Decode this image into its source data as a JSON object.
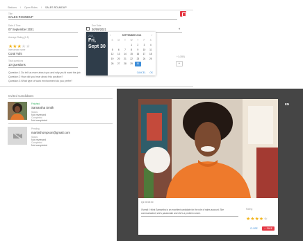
{
  "breadcrumb": [
    "Stations",
    "Open Roles",
    "SALES ROUNDUP"
  ],
  "form": {
    "title_label": "Title",
    "title_value": "SALES ROUNDUP",
    "date_label": "Date & Time",
    "date_value": "07 September 2021",
    "due_label": "Due Date",
    "due_value": "30/09/2021",
    "rating_label": "Average Rating (1-5)",
    "rating_value": 3,
    "rating_max": 5,
    "interviewer_label": "Interviewer name",
    "interviewer_value": "Coral Vuht",
    "questions_label": "Total questions",
    "questions_value": "10 Questions",
    "questions": [
      "Question 1 Do tell us more about you and why you'd want the job",
      "Question 2 How did you hear about this position?",
      "Question 3 What type of work environment do you prefer?"
    ],
    "side_note": "+1 (555)"
  },
  "datepicker": {
    "year": "2021",
    "weekday": "Fri,",
    "day_label": "Sept 30",
    "month_title": "SEPTEMBER 2021",
    "weekdays": [
      "S",
      "M",
      "T",
      "W",
      "T",
      "F",
      "S"
    ],
    "weeks": [
      [
        "",
        "",
        "",
        "1",
        "2",
        "3",
        "4"
      ],
      [
        "5",
        "6",
        "7",
        "8",
        "9",
        "10",
        "11"
      ],
      [
        "12",
        "13",
        "14",
        "15",
        "16",
        "17",
        "18"
      ],
      [
        "19",
        "20",
        "21",
        "22",
        "23",
        "24",
        "25"
      ],
      [
        "26",
        "27",
        "28",
        "29",
        "30",
        "",
        ""
      ]
    ],
    "selected": "30",
    "cancel": "CANCEL",
    "ok": "OK"
  },
  "candidates": {
    "heading": "Invited Candidates",
    "items": [
      {
        "status_label": "Finished",
        "name": "Samantha Smith",
        "status_label2": "Status",
        "status": "Not reviewed",
        "completed_label": "Completed",
        "completed": "Not completed"
      },
      {
        "status_label": "Pending",
        "name": "martinthompson@gmail.com",
        "status_label2": "Status",
        "status": "Not reviewed",
        "completed_label": "Completed",
        "completed": "Not completed"
      }
    ]
  },
  "modal": {
    "lang": "EN",
    "question_meta": "Q1 00:00:00",
    "comment": "Overall: I think Samantha is an excellent candidate for the role of sales account. She communicated, she's passionate and she's a problem solver.",
    "rating_label": "Rating",
    "rating_value": 4,
    "rating_max": 5,
    "close_button": "CLOSE",
    "save_button": "SAVE"
  },
  "colors": {
    "accent_red": "#e53945",
    "picker_dark": "#2f3d4a",
    "picker_blue": "#3c8dd9",
    "star": "#f2b316"
  }
}
